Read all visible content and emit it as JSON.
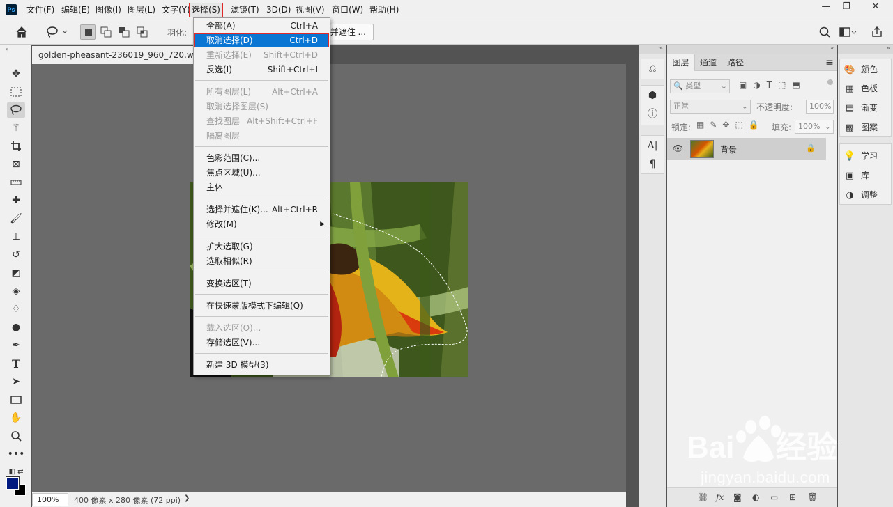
{
  "app": {
    "logo": "Ps"
  },
  "menubar": {
    "items": [
      "文件(F)",
      "编辑(E)",
      "图像(I)",
      "图层(L)",
      "文字(Y)",
      "选择(S)",
      "滤镜(T)",
      "3D(D)",
      "视图(V)",
      "窗口(W)",
      "帮助(H)"
    ],
    "active_index": 5
  },
  "window_controls": {
    "minimize": "—",
    "restore": "❐",
    "close": "✕"
  },
  "options_bar": {
    "feather_label": "羽化:",
    "select_mask_button": "并遮住 ..."
  },
  "document": {
    "tab_title": "golden-pheasant-236019_960_720.webp.j",
    "zoom": "100%",
    "status": "400 像素 x 280 像素 (72 ppi)",
    "status_arrow": "❯"
  },
  "select_menu": {
    "groups": [
      [
        {
          "label": "全部(A)",
          "shortcut": "Ctrl+A",
          "enabled": true
        },
        {
          "label": "取消选择(D)",
          "shortcut": "Ctrl+D",
          "enabled": true,
          "highlighted": true
        },
        {
          "label": "重新选择(E)",
          "shortcut": "Shift+Ctrl+D",
          "enabled": false
        },
        {
          "label": "反选(I)",
          "shortcut": "Shift+Ctrl+I",
          "enabled": true
        }
      ],
      [
        {
          "label": "所有图层(L)",
          "shortcut": "Alt+Ctrl+A",
          "enabled": false
        },
        {
          "label": "取消选择图层(S)",
          "shortcut": "",
          "enabled": false
        },
        {
          "label": "查找图层",
          "shortcut": "Alt+Shift+Ctrl+F",
          "enabled": false
        },
        {
          "label": "隔离图层",
          "shortcut": "",
          "enabled": false
        }
      ],
      [
        {
          "label": "色彩范围(C)...",
          "shortcut": "",
          "enabled": true
        },
        {
          "label": "焦点区域(U)...",
          "shortcut": "",
          "enabled": true
        },
        {
          "label": "主体",
          "shortcut": "",
          "enabled": true
        }
      ],
      [
        {
          "label": "选择并遮住(K)...",
          "shortcut": "Alt+Ctrl+R",
          "enabled": true
        },
        {
          "label": "修改(M)",
          "shortcut": "",
          "enabled": true,
          "submenu": true
        }
      ],
      [
        {
          "label": "扩大选取(G)",
          "shortcut": "",
          "enabled": true
        },
        {
          "label": "选取相似(R)",
          "shortcut": "",
          "enabled": true
        }
      ],
      [
        {
          "label": "变换选区(T)",
          "shortcut": "",
          "enabled": true
        }
      ],
      [
        {
          "label": "在快速蒙版模式下编辑(Q)",
          "shortcut": "",
          "enabled": true
        }
      ],
      [
        {
          "label": "载入选区(O)...",
          "shortcut": "",
          "enabled": false
        },
        {
          "label": "存储选区(V)...",
          "shortcut": "",
          "enabled": true
        }
      ],
      [
        {
          "label": "新建 3D 模型(3)",
          "shortcut": "",
          "enabled": true
        }
      ]
    ]
  },
  "layers_panel": {
    "tabs": [
      "图层",
      "通道",
      "路径"
    ],
    "filter_kind": "类型",
    "blend_mode": "正常",
    "opacity_label": "不透明度:",
    "opacity_value": "100%",
    "lock_label": "锁定:",
    "fill_label": "填充:",
    "fill_value": "100%",
    "layers": [
      {
        "name": "背景",
        "locked": true,
        "visible": true
      }
    ],
    "bottom_icons": [
      "link-icon",
      "fx-icon",
      "mask-icon",
      "adjustment-icon",
      "group-icon",
      "new-layer-icon",
      "trash-icon"
    ],
    "fx_text": "fx"
  },
  "right_panels": {
    "items": [
      "颜色",
      "色板",
      "渐变",
      "图案",
      "学习",
      "库",
      "调整"
    ]
  },
  "colors": {
    "foreground": "#001a80",
    "background": "#000000",
    "menu_highlight": "#0b75d4",
    "annotation_red": "#e02a2a"
  },
  "watermark": {
    "text": "jingyan.baidu.com"
  }
}
